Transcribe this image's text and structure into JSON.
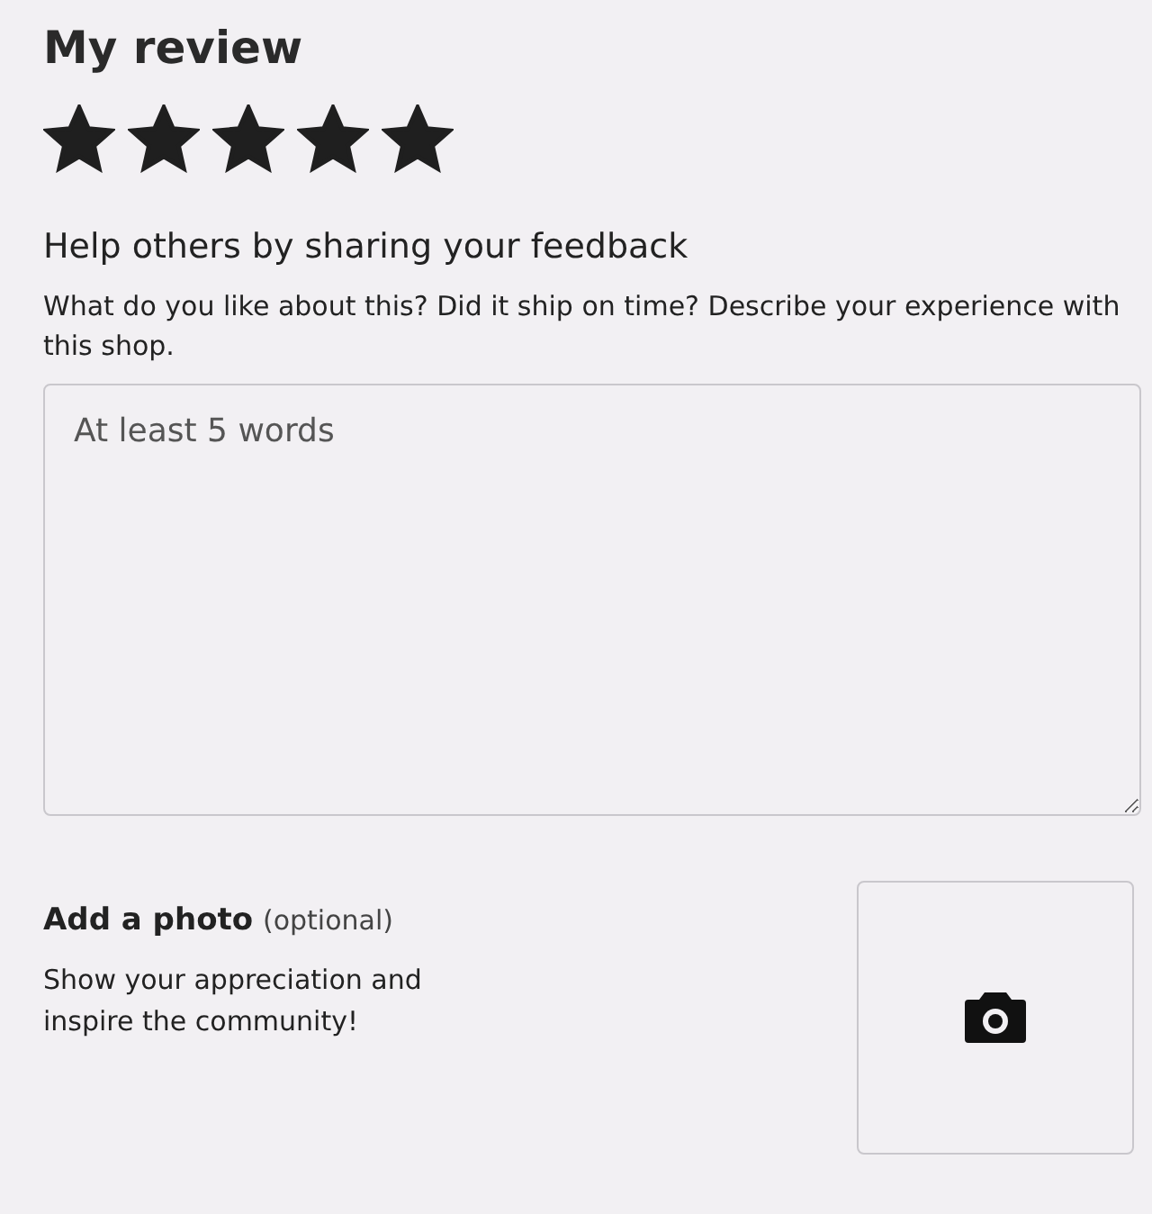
{
  "title": "My review",
  "rating": {
    "stars": 5
  },
  "feedback": {
    "heading": "Help others by sharing your feedback",
    "description": "What do you like about this? Did it ship on time? Describe your experience with this shop.",
    "placeholder": "At least 5 words"
  },
  "photo": {
    "heading": "Add a photo",
    "note": "(optional)",
    "description": "Show your appreciation and inspire the community!"
  }
}
